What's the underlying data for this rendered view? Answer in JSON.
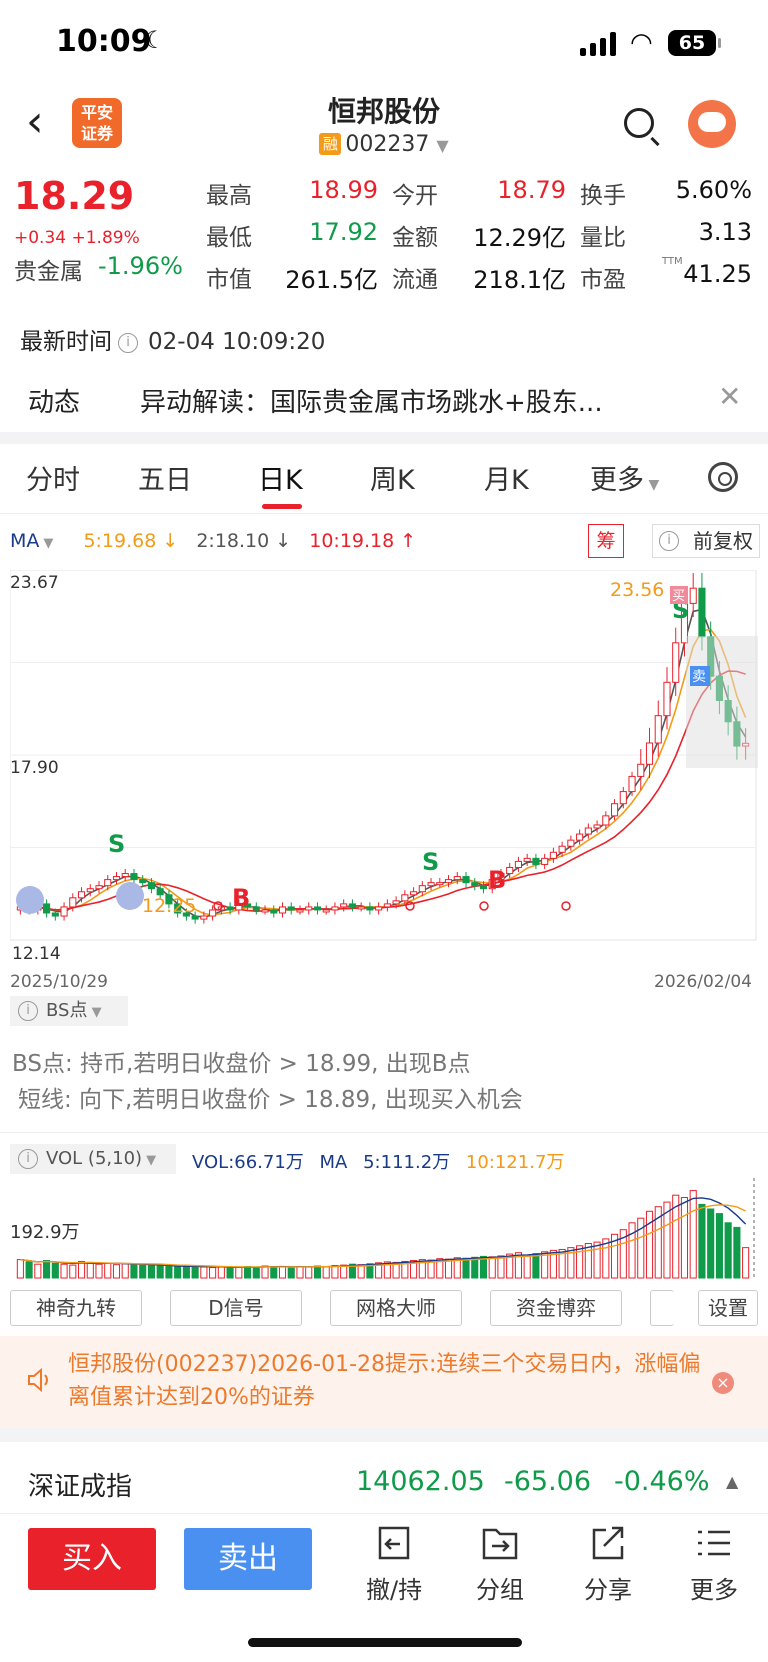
{
  "status": {
    "time": "10:09",
    "battery": "65"
  },
  "header": {
    "title": "恒邦股份",
    "badge": "融",
    "code": "002237",
    "logo_line1": "平安",
    "logo_line2": "证券"
  },
  "quote": {
    "price": "18.29",
    "change": "+0.34 +1.89%",
    "sector_label": "贵金属",
    "sector_change": "-1.96%",
    "rows": [
      [
        {
          "l": "最高",
          "v": "18.99",
          "c": "red"
        },
        {
          "l": "今开",
          "v": "18.79",
          "c": "red"
        },
        {
          "l": "换手",
          "v": "5.60%",
          "c": "dark"
        }
      ],
      [
        {
          "l": "最低",
          "v": "17.92",
          "c": "green"
        },
        {
          "l": "金额",
          "v": "12.29亿",
          "c": "dark"
        },
        {
          "l": "量比",
          "v": "3.13",
          "c": "dark"
        }
      ],
      [
        {
          "l": "市值",
          "v": "261.5亿",
          "c": "dark"
        },
        {
          "l": "流通",
          "v": "218.1亿",
          "c": "dark"
        },
        {
          "l": "市盈",
          "v": "41.25",
          "c": "dark"
        }
      ]
    ],
    "pe_sup": "TTM"
  },
  "latest": {
    "label": "最新时间",
    "value": "02-04 10:09:20"
  },
  "news": {
    "tag": "动态",
    "text": "异动解读：国际贵金属市场跳水+股东..."
  },
  "tabs": [
    "分时",
    "五日",
    "日K",
    "周K",
    "月K",
    "更多"
  ],
  "ma": {
    "label": "MA",
    "ma5": "5:19.68",
    "ma2": "2:18.10",
    "ma10": "10:19.18",
    "chou": "筹",
    "adjust": "前复权"
  },
  "chart_data": {
    "type": "candlestick",
    "ylim": [
      12.14,
      23.67
    ],
    "y_labels": [
      "23.67",
      "17.90",
      "12.14"
    ],
    "x_labels": [
      "2025/10/29",
      "2026/02/04"
    ],
    "annotations": {
      "high": "23.56",
      "low": "12.25",
      "buy_tag": "买",
      "sell_tag": "卖"
    },
    "signals": [
      "S",
      "S",
      "B",
      "B",
      "S"
    ],
    "closes": [
      12.9,
      12.8,
      13.0,
      12.7,
      12.6,
      12.9,
      13.2,
      13.4,
      13.5,
      13.6,
      13.8,
      13.9,
      14.0,
      13.8,
      13.7,
      13.5,
      13.3,
      13.0,
      12.7,
      12.6,
      12.5,
      12.6,
      12.8,
      12.9,
      12.8,
      13.0,
      12.9,
      12.8,
      12.8,
      12.7,
      12.9,
      12.8,
      12.8,
      12.9,
      12.8,
      12.8,
      12.9,
      13.0,
      12.9,
      12.9,
      12.8,
      12.9,
      13.0,
      13.1,
      13.3,
      13.4,
      13.6,
      13.7,
      13.7,
      13.8,
      13.9,
      13.7,
      13.6,
      13.5,
      13.8,
      14.0,
      14.2,
      14.4,
      14.5,
      14.3,
      14.5,
      14.7,
      14.9,
      15.1,
      15.3,
      15.5,
      15.6,
      15.9,
      16.3,
      16.7,
      17.2,
      17.6,
      18.3,
      19.2,
      20.3,
      21.6,
      22.9,
      23.4,
      21.8,
      20.5,
      19.7,
      19.0,
      18.2,
      18.29
    ]
  },
  "bs": {
    "label": "BS点",
    "line1": "BS点: 持币,若明日收盘价 > 18.99, 出现B点",
    "line2": "短线: 向下,若明日收盘价 > 18.89, 出现买入机会"
  },
  "vol": {
    "label": "VOL (5,10)",
    "vol": "VOL:66.71万",
    "ma": "MA",
    "ma5": "5:111.2万",
    "ma10": "10:121.7万",
    "axis": "192.9万",
    "values": [
      40,
      35,
      30,
      38,
      32,
      30,
      28,
      36,
      34,
      30,
      32,
      29,
      31,
      30,
      28,
      27,
      26,
      25,
      24,
      26,
      25,
      24,
      23,
      24,
      22,
      23,
      25,
      24,
      26,
      25,
      24,
      23,
      25,
      24,
      26,
      25,
      27,
      28,
      30,
      29,
      31,
      33,
      35,
      34,
      36,
      38,
      40,
      39,
      42,
      41,
      44,
      43,
      45,
      47,
      46,
      48,
      52,
      55,
      50,
      53,
      57,
      60,
      62,
      66,
      70,
      75,
      78,
      85,
      95,
      105,
      120,
      130,
      145,
      155,
      165,
      180,
      175,
      190,
      160,
      150,
      140,
      120,
      110,
      66
    ]
  },
  "tools": [
    "神奇九转",
    "D信号",
    "网格大师",
    "资金博弈",
    "设置"
  ],
  "alert": {
    "text": "恒邦股份(002237)2026-01-28提示:连续三个交易日内，涨幅偏离值累计达到20%的证券"
  },
  "index": {
    "name": "深证成指",
    "value": "14062.05",
    "change": "-65.06",
    "pct": "-0.46%"
  },
  "bottom": {
    "buy": "买入",
    "sell": "卖出",
    "items": [
      "撤/持",
      "分组",
      "分享",
      "更多"
    ]
  }
}
